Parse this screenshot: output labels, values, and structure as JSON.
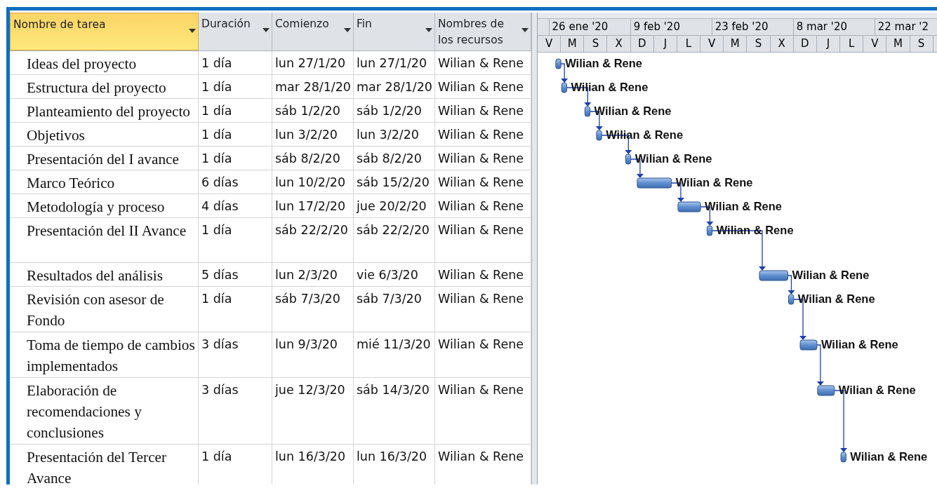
{
  "columns": [
    {
      "label": "Nombre de tarea",
      "selected": true
    },
    {
      "label": "Duración",
      "selected": false
    },
    {
      "label": "Comienzo",
      "selected": false
    },
    {
      "label": "Fin",
      "selected": false
    },
    {
      "label": "Nombres de los recursos",
      "selected": false
    }
  ],
  "tasks": [
    {
      "name": "Ideas del proyecto",
      "duration": "1 día",
      "start": "lun 27/1/20",
      "finish": "lun 27/1/20",
      "resources": "Wilian & Rene"
    },
    {
      "name": "Estructura del proyecto",
      "duration": "1 día",
      "start": "mar 28/1/20",
      "finish": "mar 28/1/20",
      "resources": "Wilian & Rene"
    },
    {
      "name": "Planteamiento del proyecto",
      "duration": "1 día",
      "start": "sáb 1/2/20",
      "finish": "sáb 1/2/20",
      "resources": "Wilian & Rene"
    },
    {
      "name": "Objetivos",
      "duration": "1 día",
      "start": "lun 3/2/20",
      "finish": "lun 3/2/20",
      "resources": "Wilian & Rene"
    },
    {
      "name": "Presentación del I avance",
      "duration": "1 día",
      "start": "sáb 8/2/20",
      "finish": "sáb 8/2/20",
      "resources": "Wilian & Rene"
    },
    {
      "name": "Marco Teórico",
      "duration": "6 días",
      "start": "lun 10/2/20",
      "finish": "sáb 15/2/20",
      "resources": "Wilian & Rene"
    },
    {
      "name": "Metodología y proceso",
      "duration": "4 días",
      "start": "lun 17/2/20",
      "finish": "jue 20/2/20",
      "resources": "Wilian & Rene"
    },
    {
      "name": "Presentación del II Avance",
      "duration": "1 día",
      "start": "sáb 22/2/20",
      "finish": "sáb 22/2/20",
      "resources": "Wilian & Rene"
    },
    {
      "name": "Resultados del análisis",
      "duration": "5 días",
      "start": "lun 2/3/20",
      "finish": "vie 6/3/20",
      "resources": "Wilian & Rene"
    },
    {
      "name": "Revisión con asesor de Fondo",
      "duration": "1 día",
      "start": "sáb 7/3/20",
      "finish": "sáb 7/3/20",
      "resources": "Wilian & Rene"
    },
    {
      "name": "Toma de tiempo de cambios implementados",
      "duration": "3 días",
      "start": "lun 9/3/20",
      "finish": "mié 11/3/20",
      "resources": "Wilian & Rene"
    },
    {
      "name": "Elaboración de recomendaciones y conclusiones",
      "duration": "3 días",
      "start": "jue 12/3/20",
      "finish": "sáb 14/3/20",
      "resources": "Wilian & Rene"
    },
    {
      "name": "Presentación del Tercer Avance",
      "duration": "1 día",
      "start": "lun 16/3/20",
      "finish": "lun 16/3/20",
      "resources": "Wilian & Rene"
    }
  ],
  "gantt": {
    "timescale_top": [
      "26 ene '20",
      "9 feb '20",
      "23 feb '20",
      "8 mar '20",
      "22 mar '2"
    ],
    "timescale_bottom": [
      "V",
      "M",
      "S",
      "X",
      "D",
      "J",
      "L",
      "V",
      "M",
      "S",
      "X",
      "D",
      "J",
      "L",
      "V",
      "M",
      "S"
    ],
    "bar_labels": [
      "Wilian & Rene",
      "Wilian & Rene",
      "Wilian & Rene",
      "Wilian & Rene",
      "Wilian & Rene",
      "Wilian & Rene",
      "Wilian & Rene",
      "Wilian & Rene",
      "Wilian & Rene",
      "Wilian & Rene",
      "Wilian & Rene",
      "Wilian & Rene",
      "Wilian & Rene"
    ]
  }
}
